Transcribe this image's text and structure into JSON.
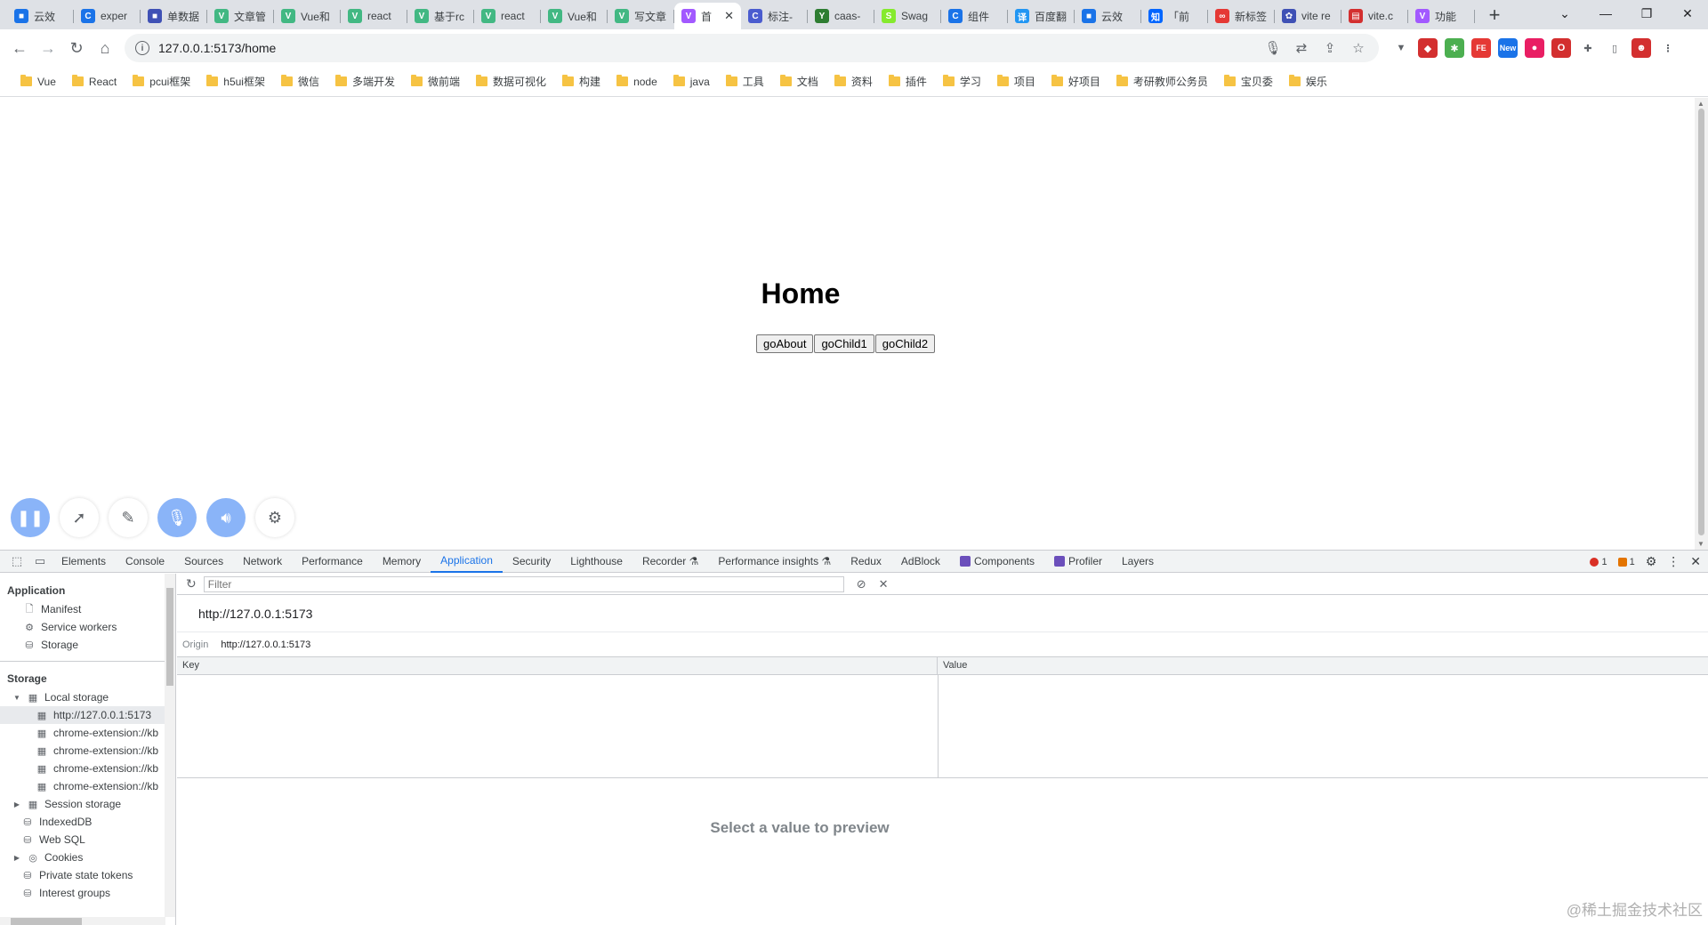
{
  "browser": {
    "tabs": [
      {
        "title": "云效",
        "color": "#1a73e8",
        "glyph": "■"
      },
      {
        "title": "exper",
        "color": "#1a73e8",
        "glyph": "C"
      },
      {
        "title": "单数据",
        "color": "#3f51b5",
        "glyph": "■"
      },
      {
        "title": "文章管",
        "color": "#42b883",
        "glyph": "V"
      },
      {
        "title": "Vue和",
        "color": "#42b883",
        "glyph": "V"
      },
      {
        "title": "react",
        "color": "#42b883",
        "glyph": "V"
      },
      {
        "title": "基于rc",
        "color": "#42b883",
        "glyph": "V"
      },
      {
        "title": "react",
        "color": "#42b883",
        "glyph": "V"
      },
      {
        "title": "Vue和",
        "color": "#42b883",
        "glyph": "V"
      },
      {
        "title": "写文章",
        "color": "#42b883",
        "glyph": "V"
      },
      {
        "title": "首",
        "color": "#a259ff",
        "glyph": "V",
        "active": true
      },
      {
        "title": "标注-",
        "color": "#4a5ccf",
        "glyph": "C"
      },
      {
        "title": "caas-",
        "color": "#2e7d32",
        "glyph": "Y"
      },
      {
        "title": "Swag",
        "color": "#85ea2d",
        "glyph": "S"
      },
      {
        "title": "组件",
        "color": "#1a73e8",
        "glyph": "C"
      },
      {
        "title": "百度翻",
        "color": "#2196f3",
        "glyph": "译"
      },
      {
        "title": "云效",
        "color": "#1a73e8",
        "glyph": "■"
      },
      {
        "title": "「前",
        "color": "#0066ff",
        "glyph": "知"
      },
      {
        "title": "新标签",
        "color": "#e53935",
        "glyph": "∞"
      },
      {
        "title": "vite re",
        "color": "#3f51b5",
        "glyph": "✿"
      },
      {
        "title": "vite.c",
        "color": "#d32f2f",
        "glyph": "▤"
      },
      {
        "title": "功能",
        "color": "#a259ff",
        "glyph": "V"
      }
    ],
    "window_controls": {
      "chevron": "⌄",
      "minimize": "—",
      "restore": "❐",
      "close": "✕"
    },
    "new_tab": "+",
    "tab_close": "✕",
    "address": {
      "url": "127.0.0.1:5173/home"
    },
    "extensions": [
      {
        "name": "filter-ext",
        "color": "#5f6368",
        "glyph": "▼"
      },
      {
        "name": "ext-red",
        "color": "#d32f2f",
        "glyph": "◆"
      },
      {
        "name": "ext-green",
        "color": "#4caf50",
        "glyph": "✱"
      },
      {
        "name": "ext-fe",
        "color": "#e53935",
        "glyph": "FE"
      },
      {
        "name": "ext-new",
        "color": "#1a73e8",
        "glyph": "New"
      },
      {
        "name": "ext-pink",
        "color": "#e91e63",
        "glyph": "●"
      },
      {
        "name": "ext-opera",
        "color": "#d32f2f",
        "glyph": "O"
      },
      {
        "name": "puzzle",
        "color": "#5f6368",
        "glyph": "✚"
      },
      {
        "name": "sidebar",
        "color": "#5f6368",
        "glyph": "▯"
      },
      {
        "name": "profile",
        "color": "#d32f2f",
        "glyph": "☻"
      },
      {
        "name": "menu",
        "color": "#5f6368",
        "glyph": "⋮"
      }
    ],
    "bookmarks": [
      "Vue",
      "React",
      "pcui框架",
      "h5ui框架",
      "微信",
      "多端开发",
      "微前端",
      "数据可视化",
      "构建",
      "node",
      "java",
      "工具",
      "文档",
      "资料",
      "插件",
      "学习",
      "项目",
      "好项目",
      "考研教师公务员",
      "宝贝委",
      "娱乐"
    ]
  },
  "page": {
    "heading": "Home",
    "buttons": [
      "goAbout",
      "goChild1",
      "goChild2"
    ]
  },
  "devtools": {
    "tabs": [
      "Elements",
      "Console",
      "Sources",
      "Network",
      "Performance",
      "Memory",
      "Application",
      "Security",
      "Lighthouse",
      "Recorder ⚗",
      "Performance insights ⚗",
      "Redux",
      "AdBlock",
      "Components",
      "Profiler",
      "Layers"
    ],
    "active_tab": "Application",
    "errors": "1",
    "warnings": "1",
    "sidebar": {
      "application_title": "Application",
      "application_items": [
        "Manifest",
        "Service workers",
        "Storage"
      ],
      "storage_title": "Storage",
      "local_storage": "Local storage",
      "local_storage_children": [
        "http://127.0.0.1:5173",
        "chrome-extension://kb",
        "chrome-extension://kb",
        "chrome-extension://kb",
        "chrome-extension://kb"
      ],
      "storage_items": [
        "Session storage",
        "IndexedDB",
        "Web SQL",
        "Cookies",
        "Private state tokens",
        "Interest groups"
      ]
    },
    "filter_placeholder": "Filter",
    "origin_title": "http://127.0.0.1:5173",
    "origin_label": "Origin",
    "origin_value": "http://127.0.0.1:5173",
    "columns": [
      "Key",
      "Value"
    ],
    "preview_text": "Select a value to preview"
  },
  "watermark": "@稀土掘金技术社区"
}
